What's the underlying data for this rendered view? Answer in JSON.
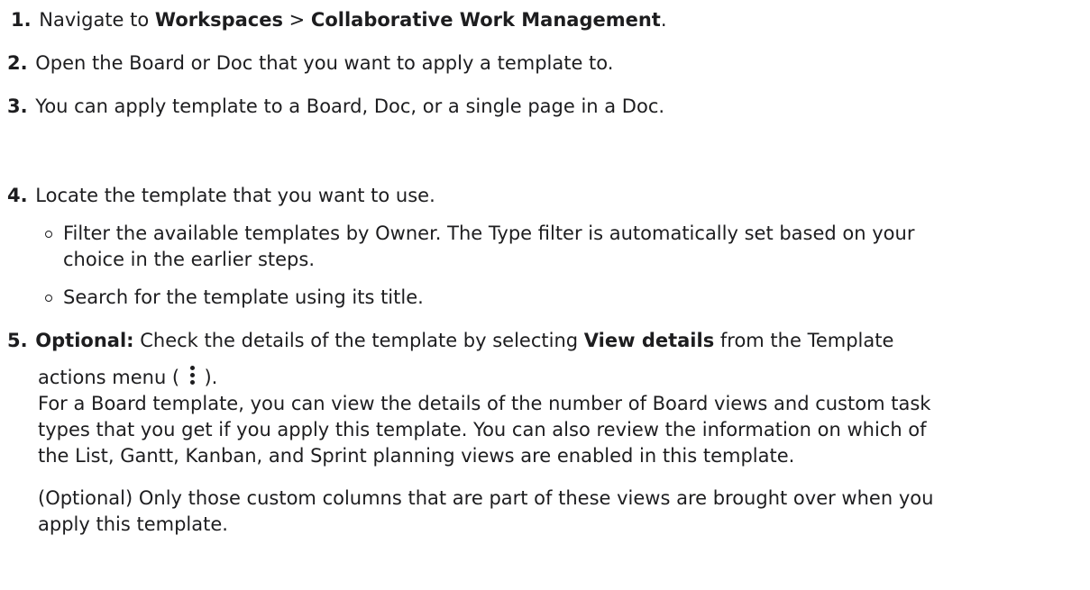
{
  "steps": [
    {
      "number": "1.",
      "parts": {
        "a": "Navigate to ",
        "b": "Workspaces",
        "c": " > ",
        "d": "Collaborative Work Management",
        "e": "."
      }
    },
    {
      "number": "2.",
      "text": "Open the Board or Doc that you want to apply a template to."
    },
    {
      "number": "3.",
      "text": "You can apply template to a Board, Doc, or a single page in a Doc."
    },
    {
      "number": "4.",
      "text": "Locate the template that you want to use.",
      "bullets": [
        {
          "line1": "Filter the available templates by Owner. The Type filter is automatically set based on your",
          "line2": "choice in the earlier steps."
        },
        {
          "line1": "Search for the template using its title."
        }
      ]
    },
    {
      "number": "5.",
      "optional_label": "Optional:",
      "text_a": " Check the details of the template by selecting ",
      "view_details": "View details",
      "text_b": " from the Template",
      "line2_a": "actions menu ( ",
      "line2_b": " ).",
      "icon": "kebab-menu-icon",
      "para1": [
        "For a Board template, you can view the details of the number of Board views and custom task",
        "types that you get if you apply this template. You can also review the information on which of",
        "the List, Gantt, Kanban, and Sprint planning views are enabled in this template."
      ],
      "para2": [
        "(Optional) Only those custom columns that are part of these views are brought over when you",
        "apply this template."
      ]
    }
  ]
}
